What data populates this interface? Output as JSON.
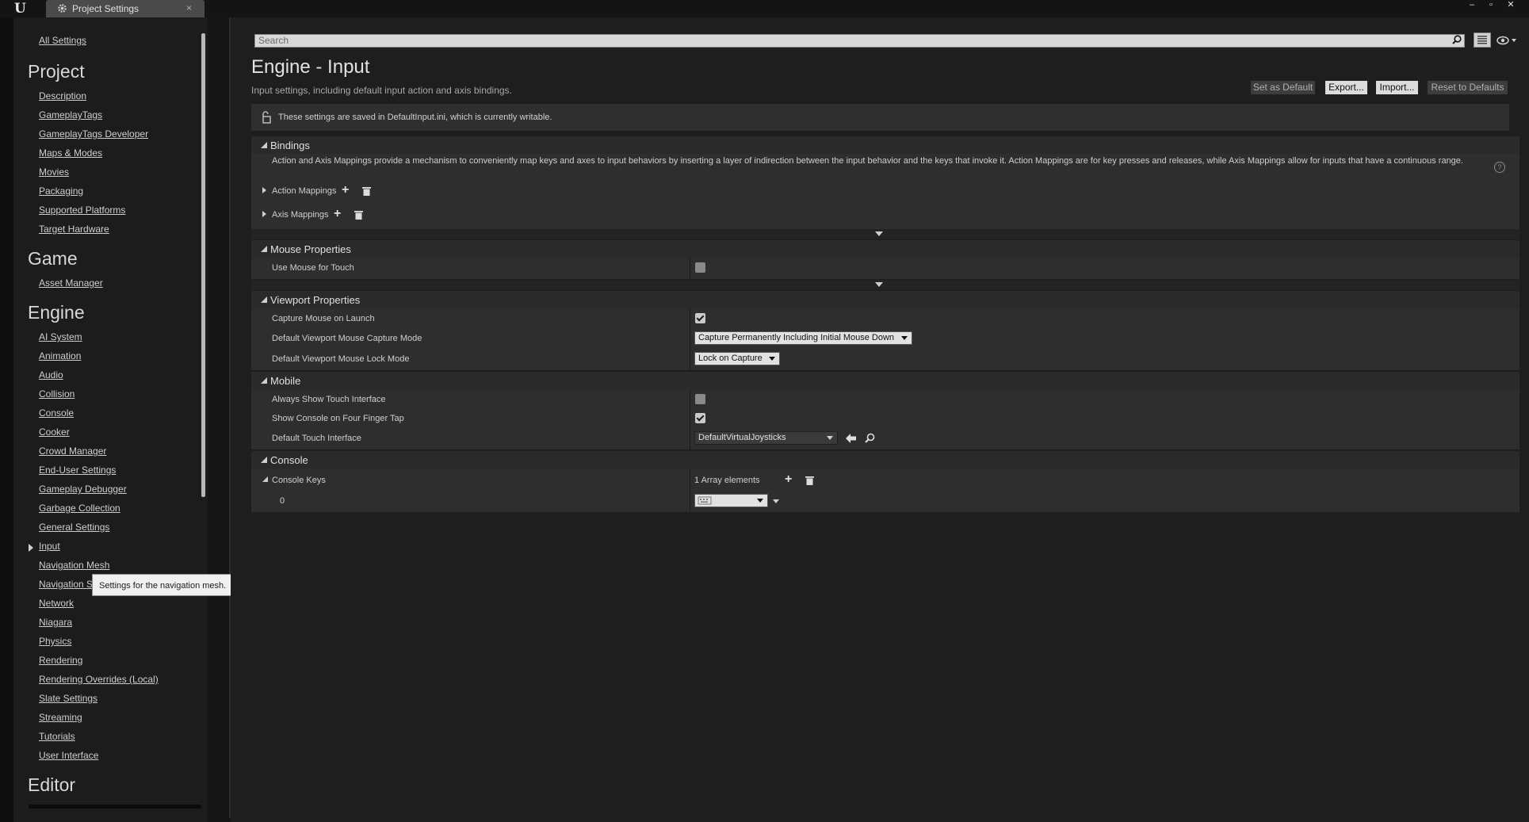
{
  "window": {
    "tab_title": "Project Settings",
    "tab_close": "×",
    "minimize": "–",
    "maximize": "▫",
    "close": "✕",
    "logo_text": "U"
  },
  "sidebar": {
    "all_settings": "All Settings",
    "categories": [
      {
        "title": "Project",
        "items": [
          "Description",
          "GameplayTags",
          "GameplayTags Developer",
          "Maps & Modes",
          "Movies",
          "Packaging",
          "Supported Platforms",
          "Target Hardware"
        ]
      },
      {
        "title": "Game",
        "items": [
          "Asset Manager"
        ]
      },
      {
        "title": "Engine",
        "items": [
          "AI System",
          "Animation",
          "Audio",
          "Collision",
          "Console",
          "Cooker",
          "Crowd Manager",
          "End-User Settings",
          "Gameplay Debugger",
          "Garbage Collection",
          "General Settings",
          "Input",
          "Navigation Mesh",
          "Navigation System",
          "Network",
          "Niagara",
          "Physics",
          "Rendering",
          "Rendering Overrides (Local)",
          "Slate Settings",
          "Streaming",
          "Tutorials",
          "User Interface"
        ]
      },
      {
        "title": "Editor",
        "items": []
      }
    ],
    "selected_item": "Input",
    "tooltip": "Settings for the navigation mesh."
  },
  "search": {
    "placeholder": "Search"
  },
  "header": {
    "title": "Engine - Input",
    "subtitle": "Input settings, including default input action and axis bindings.",
    "buttons": {
      "set_default": "Set as Default",
      "export": "Export...",
      "import": "Import...",
      "reset": "Reset to Defaults"
    },
    "notice": "These settings are saved in DefaultInput.ini, which is currently writable."
  },
  "bindings": {
    "title": "Bindings",
    "description": "Action and Axis Mappings provide a mechanism to conveniently map keys and axes to input behaviors by inserting a layer of indirection between the input behavior and the keys that invoke it. Action Mappings are for key presses and releases, while Axis Mappings allow for inputs that have a continuous range.",
    "action_mappings": "Action Mappings",
    "axis_mappings": "Axis Mappings",
    "help": "?"
  },
  "mouse": {
    "title": "Mouse Properties",
    "use_mouse_for_touch": "Use Mouse for Touch"
  },
  "viewport": {
    "title": "Viewport Properties",
    "capture_on_launch": "Capture Mouse on Launch",
    "capture_mode_label": "Default Viewport Mouse Capture Mode",
    "capture_mode_value": "Capture Permanently Including Initial Mouse Down",
    "lock_mode_label": "Default Viewport Mouse Lock Mode",
    "lock_mode_value": "Lock on Capture"
  },
  "mobile": {
    "title": "Mobile",
    "always_show_touch": "Always Show Touch Interface",
    "show_console_four_finger": "Show Console on Four Finger Tap",
    "default_touch_label": "Default Touch Interface",
    "default_touch_value": "DefaultVirtualJoysticks"
  },
  "console": {
    "title": "Console",
    "keys_label": "Console Keys",
    "array_count": "1 Array elements",
    "index0": "0"
  }
}
